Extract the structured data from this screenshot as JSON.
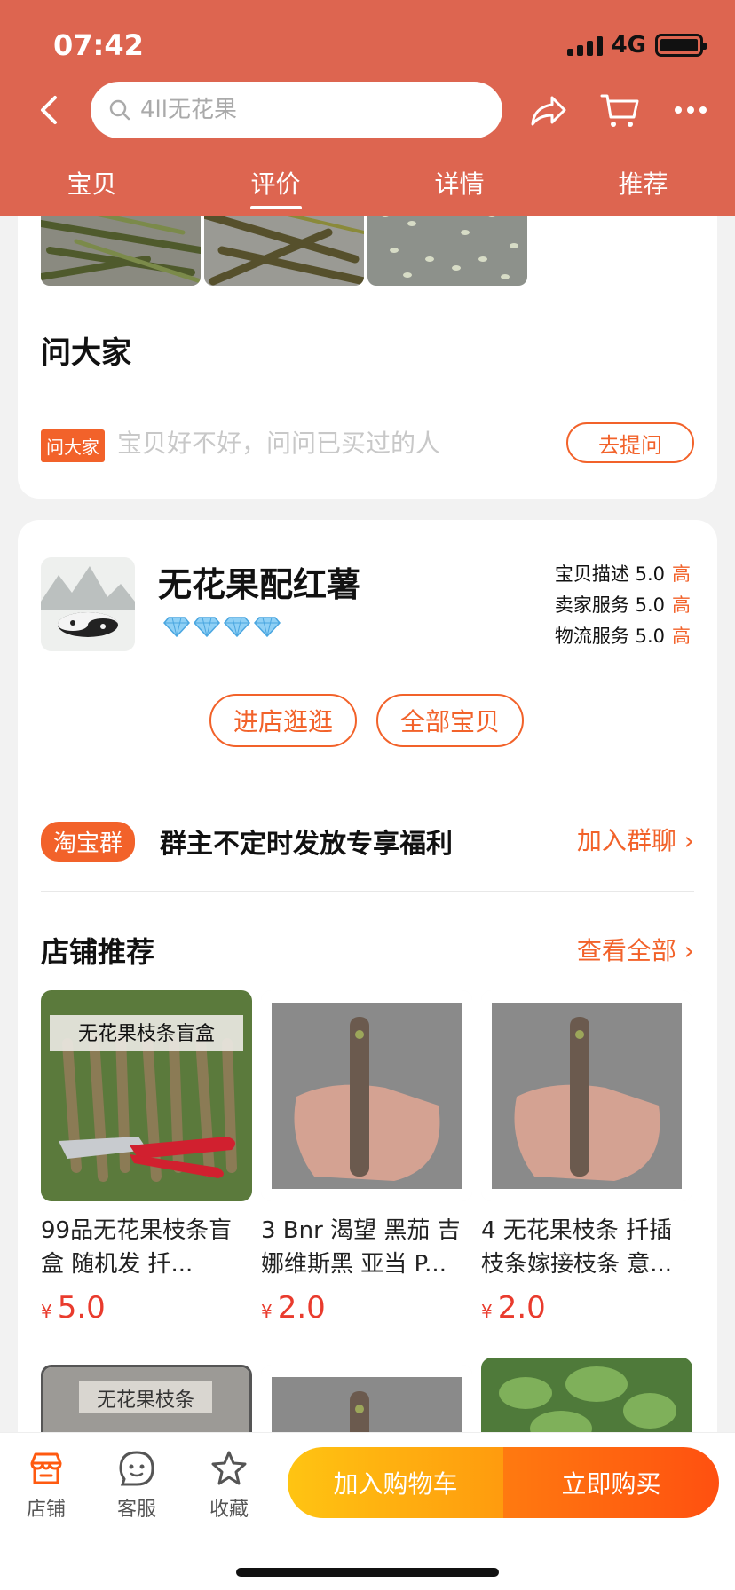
{
  "status": {
    "time": "07:42",
    "network": "4G"
  },
  "search": {
    "placeholder": "4ll无花果"
  },
  "tabs": [
    "宝贝",
    "评价",
    "详情",
    "推荐"
  ],
  "ask": {
    "title": "问大家",
    "badge": "问大家",
    "hint": "宝贝好不好，问问已买过的人",
    "button": "去提问"
  },
  "shop": {
    "name": "无花果配红薯",
    "ratings": [
      {
        "label": "宝贝描述",
        "score": "5.0",
        "level": "高"
      },
      {
        "label": "卖家服务",
        "score": "5.0",
        "level": "高"
      },
      {
        "label": "物流服务",
        "score": "5.0",
        "level": "高"
      }
    ],
    "visit_button": "进店逛逛",
    "all_button": "全部宝贝",
    "diamond_count": 4
  },
  "group": {
    "badge": "淘宝群",
    "text": "群主不定时发放专享福利",
    "link": "加入群聊"
  },
  "recommend": {
    "title": "店铺推荐",
    "link": "查看全部",
    "products": [
      {
        "name": "99品无花果枝条盲盒 随机发  扦...",
        "currency": "¥",
        "price": "5.0",
        "image_caption": "无花果枝条盲盒"
      },
      {
        "name": "3 Bnr 渴望 黑茄 吉娜维斯黑 亚当 P...",
        "currency": "¥",
        "price": "2.0"
      },
      {
        "name": "4 无花果枝条 扦插枝条嫁接枝条 意...",
        "currency": "¥",
        "price": "2.0"
      }
    ],
    "row2_caption": "无花果枝条"
  },
  "bottom_bar": {
    "shop": "店铺",
    "service": "客服",
    "favorite": "收藏",
    "add_cart": "加入购物车",
    "buy_now": "立即购买"
  },
  "colors": {
    "header": "#DD6550",
    "accent": "#F2622A",
    "price": "#E93B2D"
  }
}
